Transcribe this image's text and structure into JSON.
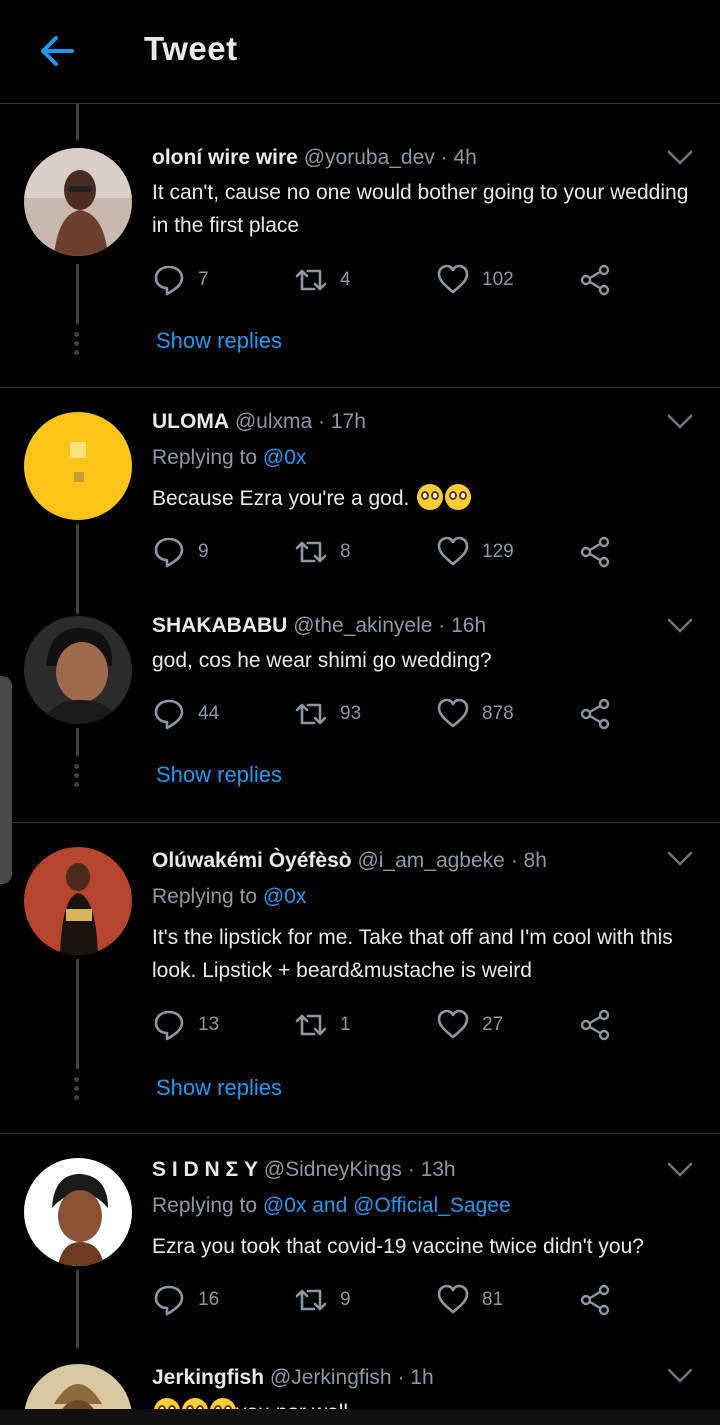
{
  "header": {
    "title": "Tweet"
  },
  "colors": {
    "accent": "#1d9bf0",
    "muted": "#8b98a5",
    "background": "#000000"
  },
  "tweets": [
    {
      "name": "oloní wire wire",
      "handle": "@yoruba_dev",
      "time": "4h",
      "replying_to": "",
      "mentions": "",
      "text": "It can't, cause no one would bother going to your wedding in the first place",
      "replies": "7",
      "retweets": "4",
      "likes": "102",
      "show_replies": "Show replies"
    },
    {
      "name": "ULOMA",
      "handle": "@ulxma",
      "time": "17h",
      "replying_to": "Replying to",
      "mentions": "@0x",
      "text": "Because Ezra you're a god.",
      "replies": "9",
      "retweets": "8",
      "likes": "129"
    },
    {
      "name": "SHAKABABU",
      "handle": "@the_akinyele",
      "time": "16h",
      "text": "god, cos he wear shimi go wedding?",
      "replies": "44",
      "retweets": "93",
      "likes": "878",
      "show_replies": "Show replies"
    },
    {
      "name": "Olúwakémi Òyéfèsò",
      "handle": "@i_am_agbeke",
      "time": "8h",
      "replying_to": "Replying to",
      "mentions": "@0x",
      "text": "It's the lipstick for me. Take that off and I'm cool with this look. Lipstick + beard&mustache is weird",
      "replies": "13",
      "retweets": "1",
      "likes": "27",
      "show_replies": "Show replies"
    },
    {
      "name": "S I D N Σ Y",
      "handle": "@SidneyKings",
      "time": "13h",
      "replying_to": "Replying to",
      "mentions": "@0x and @Official_Sagee",
      "text": "Ezra you took that covid-19 vaccine twice didn't you?",
      "replies": "16",
      "retweets": "9",
      "likes": "81"
    },
    {
      "name": "Jerkingfish",
      "handle": "@Jerkingfish",
      "time": "1h",
      "text": "you nor well"
    }
  ],
  "icons": {
    "back": "arrow-left-icon",
    "caret": "chevron-down-icon",
    "reply": "comment-icon",
    "retweet": "retweet-icon",
    "like": "heart-icon",
    "share": "share-icon"
  }
}
